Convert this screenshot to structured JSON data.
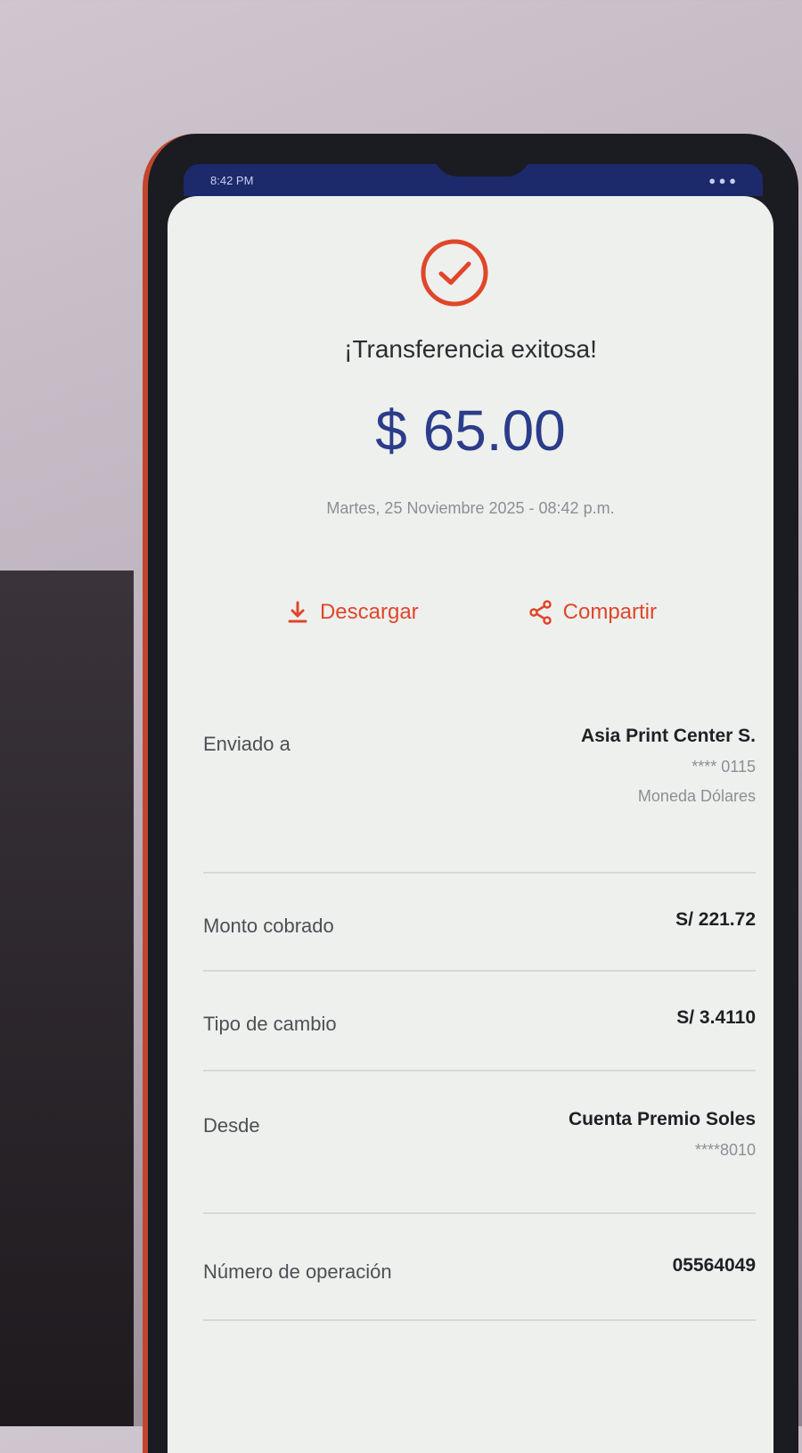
{
  "status_bar": {
    "time": "8:42 PM"
  },
  "colors": {
    "accent": "#e0462a",
    "amount": "#2b3d8a",
    "status_bar": "#1c2a6b"
  },
  "receipt": {
    "title": "¡Transferencia exitosa!",
    "amount": "$ 65.00",
    "date": "Martes, 25 Noviembre 2025 - 08:42 p.m.",
    "download_label": "Descargar",
    "share_label": "Compartir",
    "download_icon": "download-icon",
    "share_icon": "share-icon",
    "success_icon": "check-circle-icon"
  },
  "details": {
    "sent_to": {
      "label": "Enviado a",
      "name": "Asia Print Center S.",
      "account": "**** 0115",
      "currency": "Moneda Dólares"
    },
    "amount_charged": {
      "label": "Monto cobrado",
      "value": "S/ 221.72"
    },
    "exchange_rate": {
      "label": "Tipo de cambio",
      "value": "S/ 3.4110"
    },
    "from": {
      "label": "Desde",
      "account_name": "Cuenta Premio Soles",
      "account": "****8010"
    },
    "operation_number": {
      "label": "Número de operación",
      "value": "05564049"
    }
  }
}
